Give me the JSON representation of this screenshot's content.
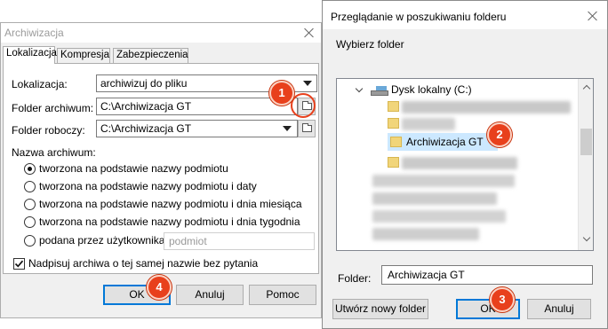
{
  "archive_dialog": {
    "title": "Archiwizacja",
    "tabs": [
      {
        "label": "Lokalizacja",
        "active": true
      },
      {
        "label": "Kompresja",
        "active": false
      },
      {
        "label": "Zabezpieczenia",
        "active": false
      }
    ],
    "location_label": "Lokalizacja:",
    "location_value": "archiwizuj do pliku",
    "archive_folder_label": "Folder archiwum:",
    "archive_folder_value": "C:\\Archiwizacja GT",
    "work_folder_label": "Folder roboczy:",
    "work_folder_value": "C:\\Archiwizacja GT",
    "archive_name_label": "Nazwa archiwum:",
    "name_options": [
      {
        "label": "tworzona na podstawie nazwy podmiotu",
        "checked": true
      },
      {
        "label": "tworzona na podstawie nazwy podmiotu i daty",
        "checked": false
      },
      {
        "label": "tworzona na podstawie nazwy podmiotu i dnia miesiąca",
        "checked": false
      },
      {
        "label": "tworzona na podstawie nazwy podmiotu i dnia tygodnia",
        "checked": false
      },
      {
        "label": "podana przez użytkownika:",
        "checked": false
      }
    ],
    "custom_name_placeholder": "podmiot",
    "overwrite_label": "Nadpisuj archiwa o tej samej nazwie bez pytania",
    "overwrite_checked": true,
    "ok_label": "OK",
    "cancel_label": "Anuluj",
    "help_label": "Pomoc"
  },
  "browse_dialog": {
    "title": "Przeglądanie w poszukiwaniu folderu",
    "subtitle": "Wybierz folder",
    "tree_root": "Dysk lokalny (C:)",
    "selected_folder": "Archiwizacja GT",
    "folder_label": "Folder:",
    "folder_value": "Archiwizacja GT",
    "new_folder_label": "Utwórz nowy folder",
    "ok_label": "OK",
    "cancel_label": "Anuluj"
  },
  "steps": [
    "1",
    "2",
    "3",
    "4"
  ],
  "colors": {
    "badge": "#e8401c",
    "default_button_border": "#0078d7",
    "selection": "#cce8ff",
    "folder": "#f1d57a"
  }
}
